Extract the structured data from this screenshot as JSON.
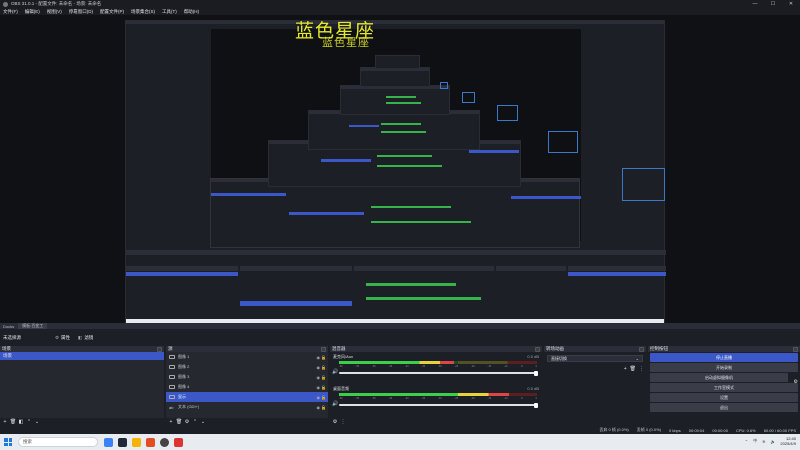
{
  "window": {
    "title": "OBS 31.0.1 - 配置文件: 未命名 - 场景: 未命名"
  },
  "menu": [
    "文件(F)",
    "编辑(E)",
    "视图(V)",
    "停靠窗口(D)",
    "配置文件(P)",
    "场景集合(S)",
    "工具(T)",
    "帮助(H)"
  ],
  "preview": {
    "watermark": "蓝色星座",
    "watermark_echo": "蓝色星座"
  },
  "dock_tabs": {
    "label": "Docks",
    "selected": "模板:百变工"
  },
  "controls": {
    "title": "未选择源",
    "btn_properties": "属性",
    "btn_filters": "滤镜"
  },
  "scenes": {
    "header": "场景",
    "items": [
      "场景"
    ]
  },
  "sources": {
    "header": "源",
    "items": [
      {
        "label": "图像 1",
        "selected": false
      },
      {
        "label": "图像 2",
        "selected": false
      },
      {
        "label": "图像 3",
        "selected": false
      },
      {
        "label": "图像 4",
        "selected": false
      },
      {
        "label": "显示",
        "selected": true
      },
      {
        "label": "文本 (GDI+)",
        "selected": false
      }
    ]
  },
  "mixer": {
    "header": "混音器",
    "channels": [
      {
        "name": "麦克风/Aux",
        "db": "0.0 dB",
        "level": 0.58
      },
      {
        "name": "桌面音频",
        "db": "0.0 dB",
        "level": 0.86
      }
    ],
    "ticks": [
      "-60",
      "-55",
      "-50",
      "-45",
      "-40",
      "-35",
      "-30",
      "-25",
      "-20",
      "-15",
      "-10",
      "-5",
      "0"
    ]
  },
  "transitions": {
    "header": "转场动画",
    "selected": "直接切换"
  },
  "controls_dock": {
    "header": "控制按钮",
    "buttons": [
      "停止直播",
      "开始录制",
      "启动虚拟摄像机",
      "工作室模式",
      "设置",
      "退出"
    ]
  },
  "status": {
    "dropped": "丢弃 0 帧 (0.0%)",
    "recording_frames": "丢帧 0 (0.0%)",
    "bitrate": "0 kbps",
    "stream_time": "00:00:04",
    "rec_time": "00:00:00",
    "cpu": "CPU: 0.6%",
    "fps": "60.00 / 60.00 FPS"
  },
  "taskbar": {
    "search_placeholder": "搜索",
    "time": "12:40",
    "date": "2025/4/9",
    "lang": "中"
  }
}
